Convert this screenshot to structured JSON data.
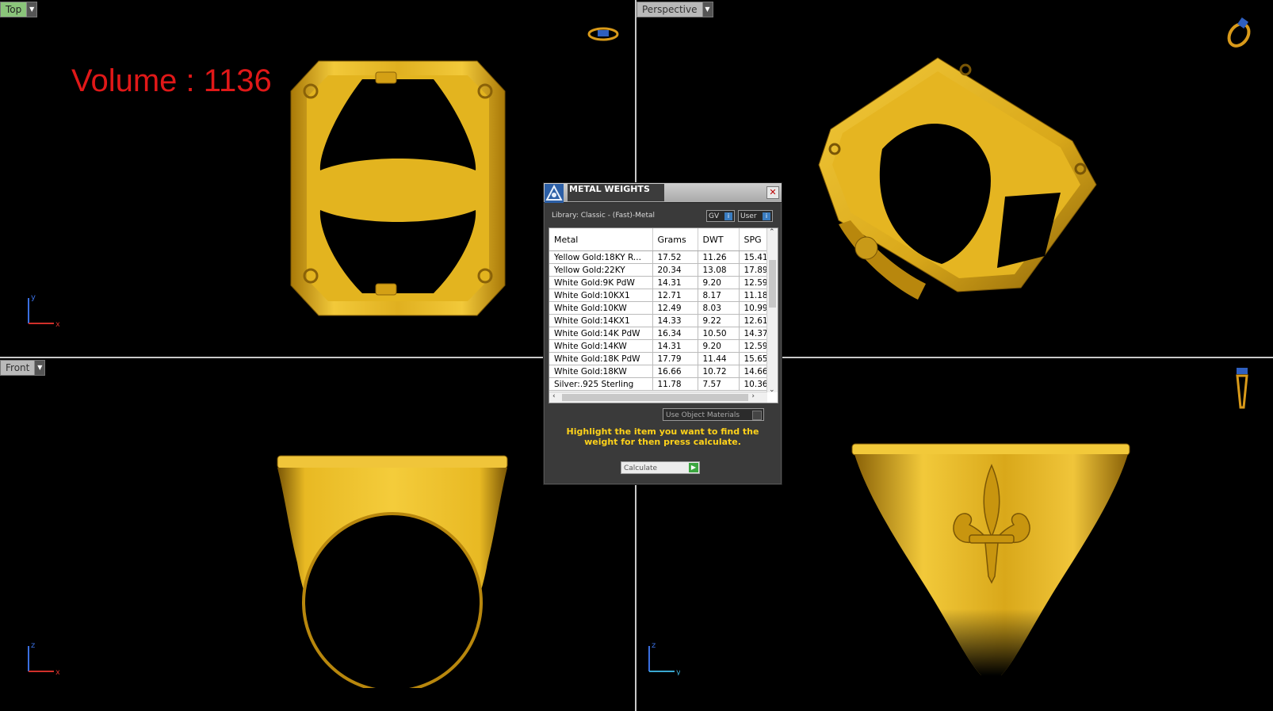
{
  "viewports": {
    "top": {
      "label": "Top",
      "volume": "Volume : 1136"
    },
    "perspective": {
      "label": "Perspective"
    },
    "front": {
      "label": "Front"
    }
  },
  "dialog": {
    "title": "METAL WEIGHTS",
    "library": "Library: Classic - (Fast)-Metal",
    "gv_label": "GV",
    "user_label": "User",
    "columns": [
      "Metal",
      "Grams",
      "DWT",
      "SPG"
    ],
    "rows": [
      [
        "Yellow Gold:18KY R...",
        "17.52",
        "11.26",
        "15.41"
      ],
      [
        "Yellow Gold:22KY",
        "20.34",
        "13.08",
        "17.89"
      ],
      [
        "White Gold:9K PdW",
        "14.31",
        "9.20",
        "12.59"
      ],
      [
        "White Gold:10KX1",
        "12.71",
        "8.17",
        "11.18"
      ],
      [
        "White Gold:10KW",
        "12.49",
        "8.03",
        "10.99"
      ],
      [
        "White Gold:14KX1",
        "14.33",
        "9.22",
        "12.61"
      ],
      [
        "White Gold:14K PdW",
        "16.34",
        "10.50",
        "14.37"
      ],
      [
        "White Gold:14KW",
        "14.31",
        "9.20",
        "12.59"
      ],
      [
        "White Gold:18K PdW",
        "17.79",
        "11.44",
        "15.65"
      ],
      [
        "White Gold:18KW",
        "16.66",
        "10.72",
        "14.66"
      ],
      [
        "Silver:.925 Sterling",
        "11.78",
        "7.57",
        "10.36"
      ]
    ],
    "use_object_materials": "Use Object Materials",
    "hint": "Highlight the item you want to find the weight for then press calculate.",
    "calculate_label": "Calculate"
  },
  "axes": {
    "top": {
      "vertical": "y",
      "horizontal": "x"
    },
    "front": {
      "vertical": "z",
      "horizontal": "x"
    },
    "right": {
      "vertical": "z",
      "horizontal": "y"
    }
  },
  "colors": {
    "gold": "#e3b21e",
    "gold_dark": "#8a6208",
    "volume_red": "#e01818",
    "hint_yellow": "#ffd21a"
  }
}
